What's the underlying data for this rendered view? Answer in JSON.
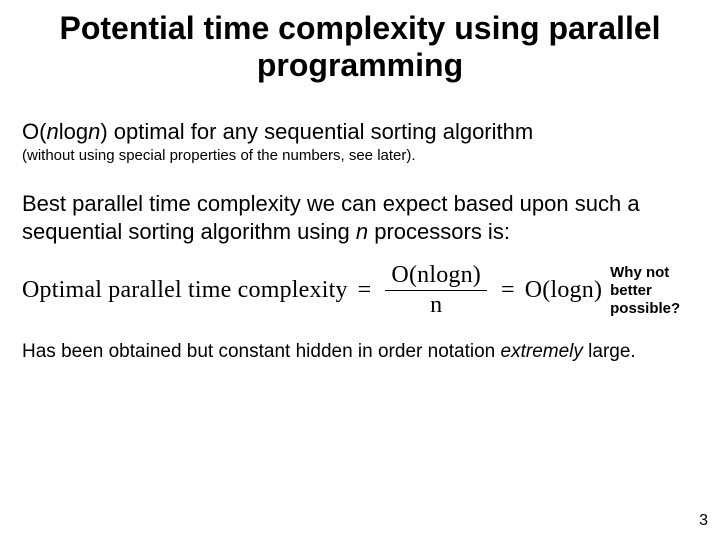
{
  "title": "Potential time complexity using parallel programming",
  "line1_a": "O(",
  "line1_b": "n",
  "line1_c": "log",
  "line1_d": "n",
  "line1_e": ") optimal for any sequential sorting algorithm",
  "note": "(without using special properties of the numbers, see later).",
  "para_a": "Best parallel time complexity we can expect based upon such a sequential sorting algorithm using ",
  "para_b": "n",
  "para_c": " processors is:",
  "eq_lhs": "Optimal parallel time complexity",
  "eq_eq": "=",
  "eq_num": "O(nlogn)",
  "eq_den": "n",
  "eq_rhs": "O(logn)",
  "aside": "Why not better possible?",
  "closing_a": "Has been obtained but constant hidden in order notation ",
  "closing_b": "extremely",
  "closing_c": " large.",
  "pagenum": "3"
}
